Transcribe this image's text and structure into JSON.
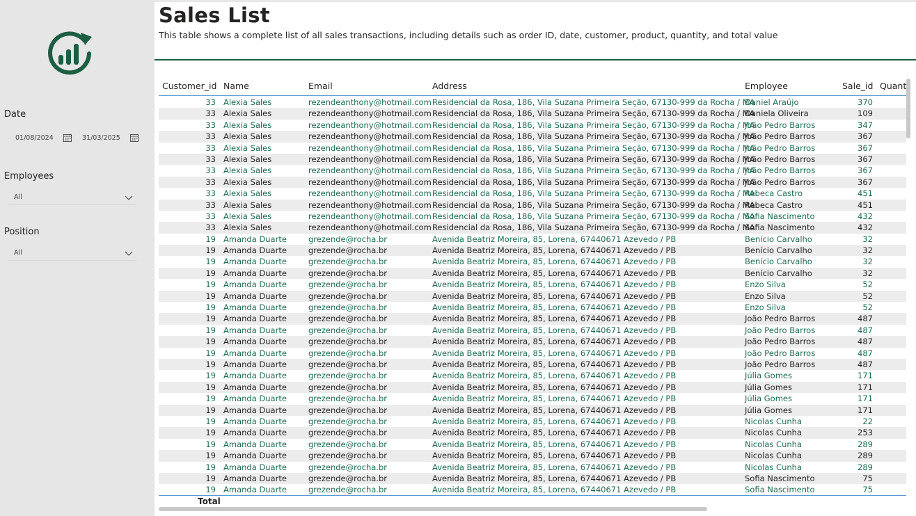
{
  "report": {
    "title": "Sales List",
    "subtitle": "This table shows a complete list of all sales transactions, including details such as order ID, date, customer, product, quantity, and total value"
  },
  "filters": {
    "date_label": "Date",
    "date_start": "01/08/2024",
    "date_end": "31/03/2025",
    "employees_label": "Employees",
    "employees_value": "All",
    "position_label": "Position",
    "position_value": "All"
  },
  "colors": {
    "brand": "#1b5e42",
    "accent": "#1f6b52",
    "sidebar": "#e6e6e6",
    "header_line": "#5b9bd5"
  },
  "table": {
    "columns": [
      "Customer_id",
      "Name",
      "Email",
      "Address",
      "Employee",
      "Sale_id",
      "Quant"
    ],
    "total_label": "Total",
    "rows": [
      [
        "33",
        "Alexia Sales",
        "rezendeanthony@hotmail.com",
        "Residencial da Rosa, 186, Vila Suzana Primeira Seção, 67130-999 da Rocha / MA",
        "Daniel Araújo",
        "370"
      ],
      [
        "33",
        "Alexia Sales",
        "rezendeanthony@hotmail.com",
        "Residencial da Rosa, 186, Vila Suzana Primeira Seção, 67130-999 da Rocha / MA",
        "Daniela Oliveira",
        "109"
      ],
      [
        "33",
        "Alexia Sales",
        "rezendeanthony@hotmail.com",
        "Residencial da Rosa, 186, Vila Suzana Primeira Seção, 67130-999 da Rocha / MA",
        "João Pedro Barros",
        "347"
      ],
      [
        "33",
        "Alexia Sales",
        "rezendeanthony@hotmail.com",
        "Residencial da Rosa, 186, Vila Suzana Primeira Seção, 67130-999 da Rocha / MA",
        "João Pedro Barros",
        "367"
      ],
      [
        "33",
        "Alexia Sales",
        "rezendeanthony@hotmail.com",
        "Residencial da Rosa, 186, Vila Suzana Primeira Seção, 67130-999 da Rocha / MA",
        "João Pedro Barros",
        "367"
      ],
      [
        "33",
        "Alexia Sales",
        "rezendeanthony@hotmail.com",
        "Residencial da Rosa, 186, Vila Suzana Primeira Seção, 67130-999 da Rocha / MA",
        "João Pedro Barros",
        "367"
      ],
      [
        "33",
        "Alexia Sales",
        "rezendeanthony@hotmail.com",
        "Residencial da Rosa, 186, Vila Suzana Primeira Seção, 67130-999 da Rocha / MA",
        "João Pedro Barros",
        "367"
      ],
      [
        "33",
        "Alexia Sales",
        "rezendeanthony@hotmail.com",
        "Residencial da Rosa, 186, Vila Suzana Primeira Seção, 67130-999 da Rocha / MA",
        "João Pedro Barros",
        "367"
      ],
      [
        "33",
        "Alexia Sales",
        "rezendeanthony@hotmail.com",
        "Residencial da Rosa, 186, Vila Suzana Primeira Seção, 67130-999 da Rocha / MA",
        "Rebeca Castro",
        "451"
      ],
      [
        "33",
        "Alexia Sales",
        "rezendeanthony@hotmail.com",
        "Residencial da Rosa, 186, Vila Suzana Primeira Seção, 67130-999 da Rocha / MA",
        "Rebeca Castro",
        "451"
      ],
      [
        "33",
        "Alexia Sales",
        "rezendeanthony@hotmail.com",
        "Residencial da Rosa, 186, Vila Suzana Primeira Seção, 67130-999 da Rocha / MA",
        "Sofia Nascimento",
        "432"
      ],
      [
        "33",
        "Alexia Sales",
        "rezendeanthony@hotmail.com",
        "Residencial da Rosa, 186, Vila Suzana Primeira Seção, 67130-999 da Rocha / MA",
        "Sofia Nascimento",
        "432"
      ],
      [
        "19",
        "Amanda Duarte",
        "grezende@rocha.br",
        "Avenida Beatriz Moreira, 85, Lorena, 67440671 Azevedo / PB",
        "Benício Carvalho",
        "32"
      ],
      [
        "19",
        "Amanda Duarte",
        "grezende@rocha.br",
        "Avenida Beatriz Moreira, 85, Lorena, 67440671 Azevedo / PB",
        "Benício Carvalho",
        "32"
      ],
      [
        "19",
        "Amanda Duarte",
        "grezende@rocha.br",
        "Avenida Beatriz Moreira, 85, Lorena, 67440671 Azevedo / PB",
        "Benício Carvalho",
        "32"
      ],
      [
        "19",
        "Amanda Duarte",
        "grezende@rocha.br",
        "Avenida Beatriz Moreira, 85, Lorena, 67440671 Azevedo / PB",
        "Benício Carvalho",
        "32"
      ],
      [
        "19",
        "Amanda Duarte",
        "grezende@rocha.br",
        "Avenida Beatriz Moreira, 85, Lorena, 67440671 Azevedo / PB",
        "Enzo Silva",
        "52"
      ],
      [
        "19",
        "Amanda Duarte",
        "grezende@rocha.br",
        "Avenida Beatriz Moreira, 85, Lorena, 67440671 Azevedo / PB",
        "Enzo Silva",
        "52"
      ],
      [
        "19",
        "Amanda Duarte",
        "grezende@rocha.br",
        "Avenida Beatriz Moreira, 85, Lorena, 67440671 Azevedo / PB",
        "Enzo Silva",
        "52"
      ],
      [
        "19",
        "Amanda Duarte",
        "grezende@rocha.br",
        "Avenida Beatriz Moreira, 85, Lorena, 67440671 Azevedo / PB",
        "João Pedro Barros",
        "487"
      ],
      [
        "19",
        "Amanda Duarte",
        "grezende@rocha.br",
        "Avenida Beatriz Moreira, 85, Lorena, 67440671 Azevedo / PB",
        "João Pedro Barros",
        "487"
      ],
      [
        "19",
        "Amanda Duarte",
        "grezende@rocha.br",
        "Avenida Beatriz Moreira, 85, Lorena, 67440671 Azevedo / PB",
        "João Pedro Barros",
        "487"
      ],
      [
        "19",
        "Amanda Duarte",
        "grezende@rocha.br",
        "Avenida Beatriz Moreira, 85, Lorena, 67440671 Azevedo / PB",
        "João Pedro Barros",
        "487"
      ],
      [
        "19",
        "Amanda Duarte",
        "grezende@rocha.br",
        "Avenida Beatriz Moreira, 85, Lorena, 67440671 Azevedo / PB",
        "João Pedro Barros",
        "487"
      ],
      [
        "19",
        "Amanda Duarte",
        "grezende@rocha.br",
        "Avenida Beatriz Moreira, 85, Lorena, 67440671 Azevedo / PB",
        "Júlia Gomes",
        "171"
      ],
      [
        "19",
        "Amanda Duarte",
        "grezende@rocha.br",
        "Avenida Beatriz Moreira, 85, Lorena, 67440671 Azevedo / PB",
        "Júlia Gomes",
        "171"
      ],
      [
        "19",
        "Amanda Duarte",
        "grezende@rocha.br",
        "Avenida Beatriz Moreira, 85, Lorena, 67440671 Azevedo / PB",
        "Júlia Gomes",
        "171"
      ],
      [
        "19",
        "Amanda Duarte",
        "grezende@rocha.br",
        "Avenida Beatriz Moreira, 85, Lorena, 67440671 Azevedo / PB",
        "Júlia Gomes",
        "171"
      ],
      [
        "19",
        "Amanda Duarte",
        "grezende@rocha.br",
        "Avenida Beatriz Moreira, 85, Lorena, 67440671 Azevedo / PB",
        "Nicolas Cunha",
        "22"
      ],
      [
        "19",
        "Amanda Duarte",
        "grezende@rocha.br",
        "Avenida Beatriz Moreira, 85, Lorena, 67440671 Azevedo / PB",
        "Nicolas Cunha",
        "253"
      ],
      [
        "19",
        "Amanda Duarte",
        "grezende@rocha.br",
        "Avenida Beatriz Moreira, 85, Lorena, 67440671 Azevedo / PB",
        "Nicolas Cunha",
        "289"
      ],
      [
        "19",
        "Amanda Duarte",
        "grezende@rocha.br",
        "Avenida Beatriz Moreira, 85, Lorena, 67440671 Azevedo / PB",
        "Nicolas Cunha",
        "289"
      ],
      [
        "19",
        "Amanda Duarte",
        "grezende@rocha.br",
        "Avenida Beatriz Moreira, 85, Lorena, 67440671 Azevedo / PB",
        "Nicolas Cunha",
        "289"
      ],
      [
        "19",
        "Amanda Duarte",
        "grezende@rocha.br",
        "Avenida Beatriz Moreira, 85, Lorena, 67440671 Azevedo / PB",
        "Sofia Nascimento",
        "75"
      ],
      [
        "19",
        "Amanda Duarte",
        "grezende@rocha.br",
        "Avenida Beatriz Moreira, 85, Lorena, 67440671 Azevedo / PB",
        "Sofia Nascimento",
        "75"
      ]
    ]
  }
}
